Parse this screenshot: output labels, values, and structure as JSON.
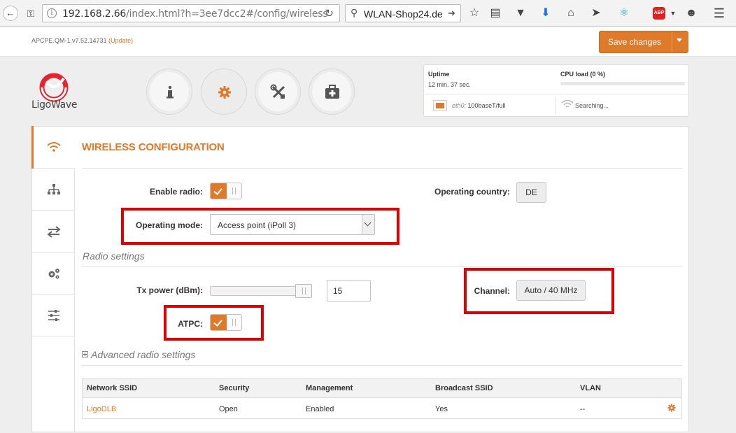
{
  "browser": {
    "url_host": "192.168.2.66",
    "url_path": "/index.html?h=3ee7dcc2#/config/wireless",
    "search_text": "WLAN-Shop24.de",
    "abp_label": "ABP"
  },
  "header": {
    "version": "APCPE.QM-1.v7.52.14731",
    "update_label": "(Update)",
    "save_label": "Save changes"
  },
  "logo": {
    "text": "LigoWave"
  },
  "status": {
    "uptime_label": "Uptime",
    "uptime_value": "12 min. 37 sec.",
    "cpu_label": "CPU load (0 %)",
    "cpu_load_percent": 0,
    "eth_name": "eth0:",
    "eth_value": "100baseT/full",
    "wireless_status": "Searching..."
  },
  "wireless": {
    "title": "WIRELESS CONFIGURATION",
    "enable_radio_label": "Enable radio:",
    "enable_radio_on": true,
    "country_label": "Operating country:",
    "country_value": "DE",
    "mode_label": "Operating mode:",
    "mode_value": "Access point (iPoll 3)",
    "radio_settings_label": "Radio settings",
    "tx_power_label": "Tx power (dBm):",
    "tx_power_value": "15",
    "channel_label": "Channel:",
    "channel_value": "Auto / 40 MHz",
    "atpc_label": "ATPC:",
    "atpc_on": true,
    "advanced_label": "Advanced radio settings"
  },
  "ssid_table": {
    "headers": [
      "Network SSID",
      "Security",
      "Management",
      "Broadcast SSID",
      "VLAN"
    ],
    "rows": [
      [
        "LigoDLB",
        "Open",
        "Enabled",
        "Yes",
        "--"
      ]
    ]
  },
  "colors": {
    "accent": "#e07a2b",
    "highlight": "#e00000"
  },
  "icons": {
    "nav": [
      "info-icon",
      "gear-icon",
      "tools-icon",
      "first-aid-icon"
    ],
    "sidebar": [
      "wifi-icon",
      "network-icon",
      "arrows-icon",
      "gears-icon",
      "sliders-icon"
    ]
  }
}
